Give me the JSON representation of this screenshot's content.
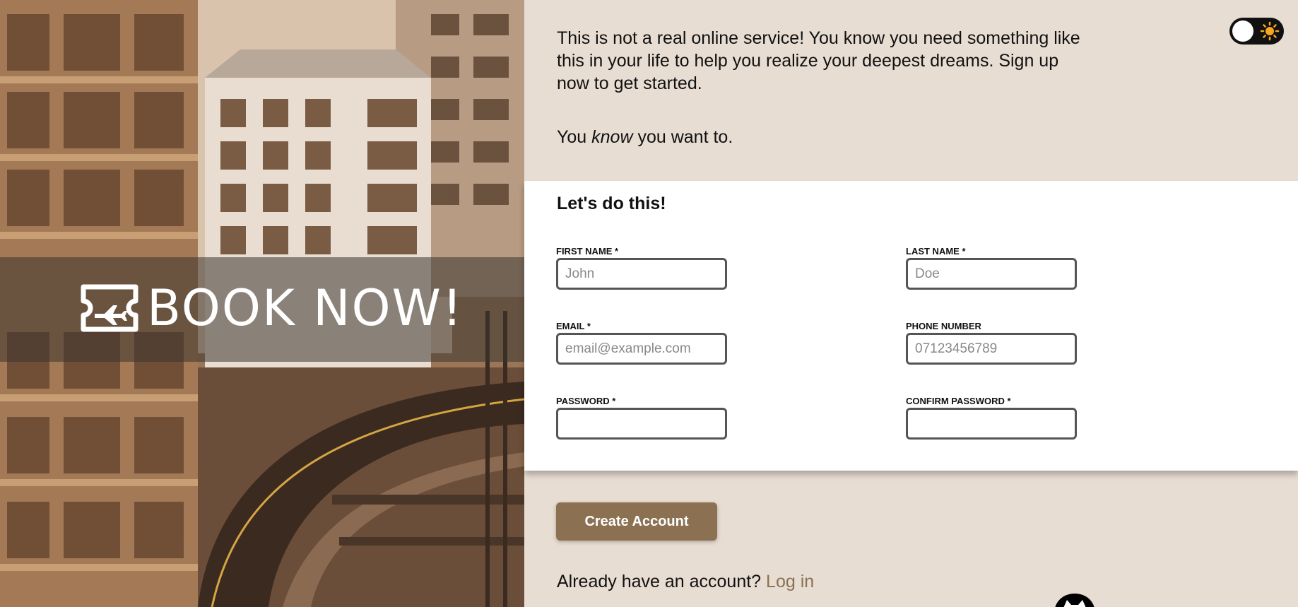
{
  "hero": {
    "logo_icon": "plane-ticket-icon",
    "logo_text": "BOOK NOW!"
  },
  "theme_toggle": {
    "icon": "sun-icon",
    "state": "light"
  },
  "intro": {
    "paragraph": "This is not a real online service! You know you need something like this in your life to help you realize your deepest dreams. Sign up now to get started.",
    "line2_before": "You ",
    "line2_em": "know",
    "line2_after": " you want to."
  },
  "form": {
    "title": "Let's do this!",
    "first_name": {
      "label": "FIRST NAME *",
      "placeholder": "John",
      "value": ""
    },
    "last_name": {
      "label": "LAST NAME *",
      "placeholder": "Doe",
      "value": ""
    },
    "email": {
      "label": "EMAIL *",
      "placeholder": "email@example.com",
      "value": ""
    },
    "phone": {
      "label": "PHONE NUMBER",
      "placeholder": "07123456789",
      "value": ""
    },
    "password": {
      "label": "PASSWORD *",
      "placeholder": "",
      "value": ""
    },
    "confirm_password": {
      "label": "CONFIRM PASSWORD *",
      "placeholder": "",
      "value": ""
    }
  },
  "actions": {
    "create_account_label": "Create Account",
    "login_prompt": "Already have an account? ",
    "login_link": "Log in"
  },
  "footer": {
    "icon": "github-octocat-icon"
  },
  "colors": {
    "background": "#e8ddd2",
    "accent": "#8b7152",
    "card": "#ffffff",
    "input_border": "#555555",
    "sun": "#f5a623"
  }
}
